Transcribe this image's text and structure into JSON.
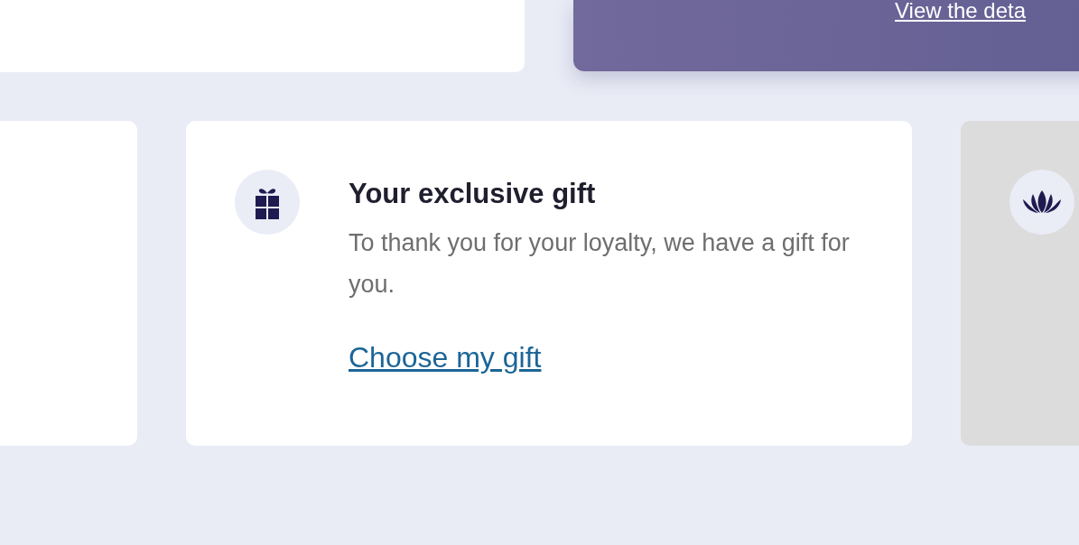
{
  "top_banner": {
    "link": "View the deta"
  },
  "gift_card": {
    "title": "Your exclusive gift",
    "description": "To thank you for your loyalty, we have a gift for you.",
    "link": "Choose my gift"
  }
}
